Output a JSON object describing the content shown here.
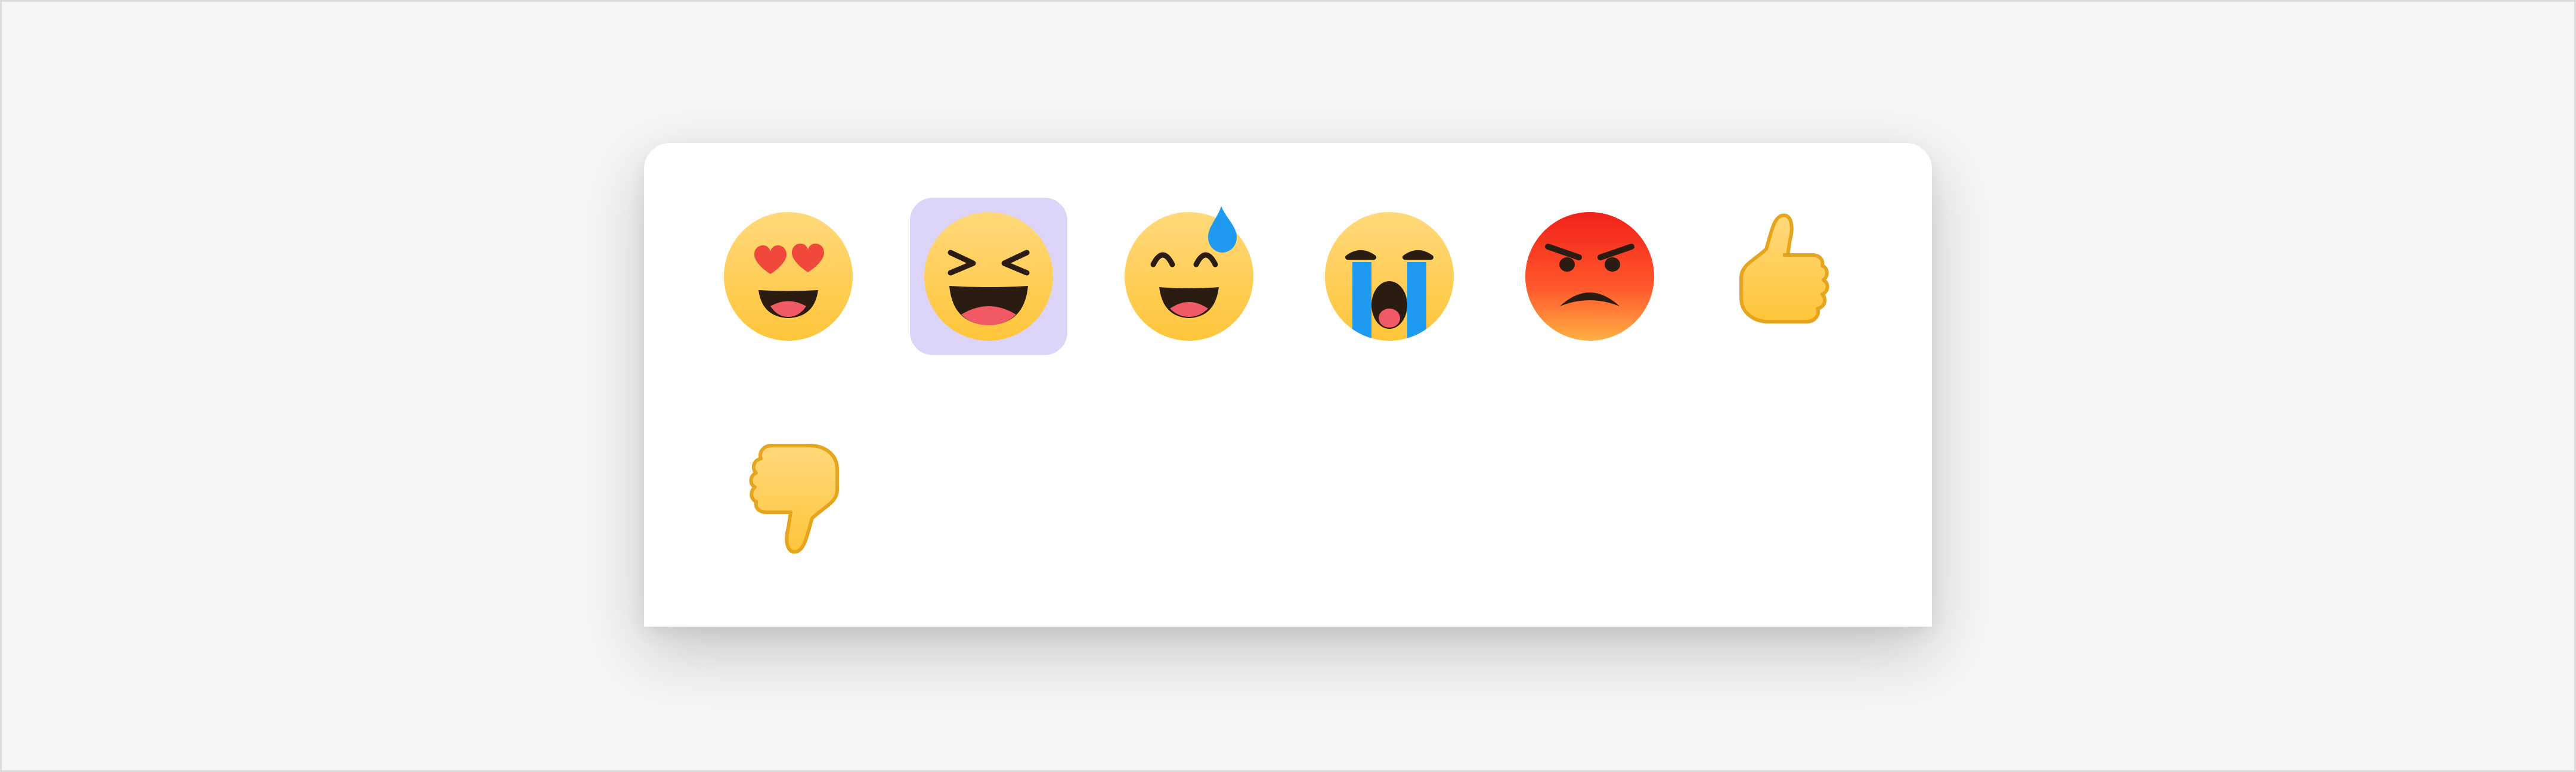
{
  "picker": {
    "selected_index": 1,
    "colors": {
      "selected_background": "#ddd4f9",
      "panel": "#ffffff",
      "page": "#f6f6f6"
    },
    "reactions": [
      {
        "name": "heart-eyes",
        "icon": "heart-eyes-face-icon"
      },
      {
        "name": "laughing",
        "icon": "squinting-laughing-face-icon"
      },
      {
        "name": "sweat-smile",
        "icon": "grinning-sweat-face-icon"
      },
      {
        "name": "crying",
        "icon": "loudly-crying-face-icon"
      },
      {
        "name": "angry",
        "icon": "angry-red-face-icon"
      },
      {
        "name": "thumbs-up",
        "icon": "thumbs-up-icon"
      },
      {
        "name": "thumbs-down",
        "icon": "thumbs-down-icon"
      }
    ]
  }
}
